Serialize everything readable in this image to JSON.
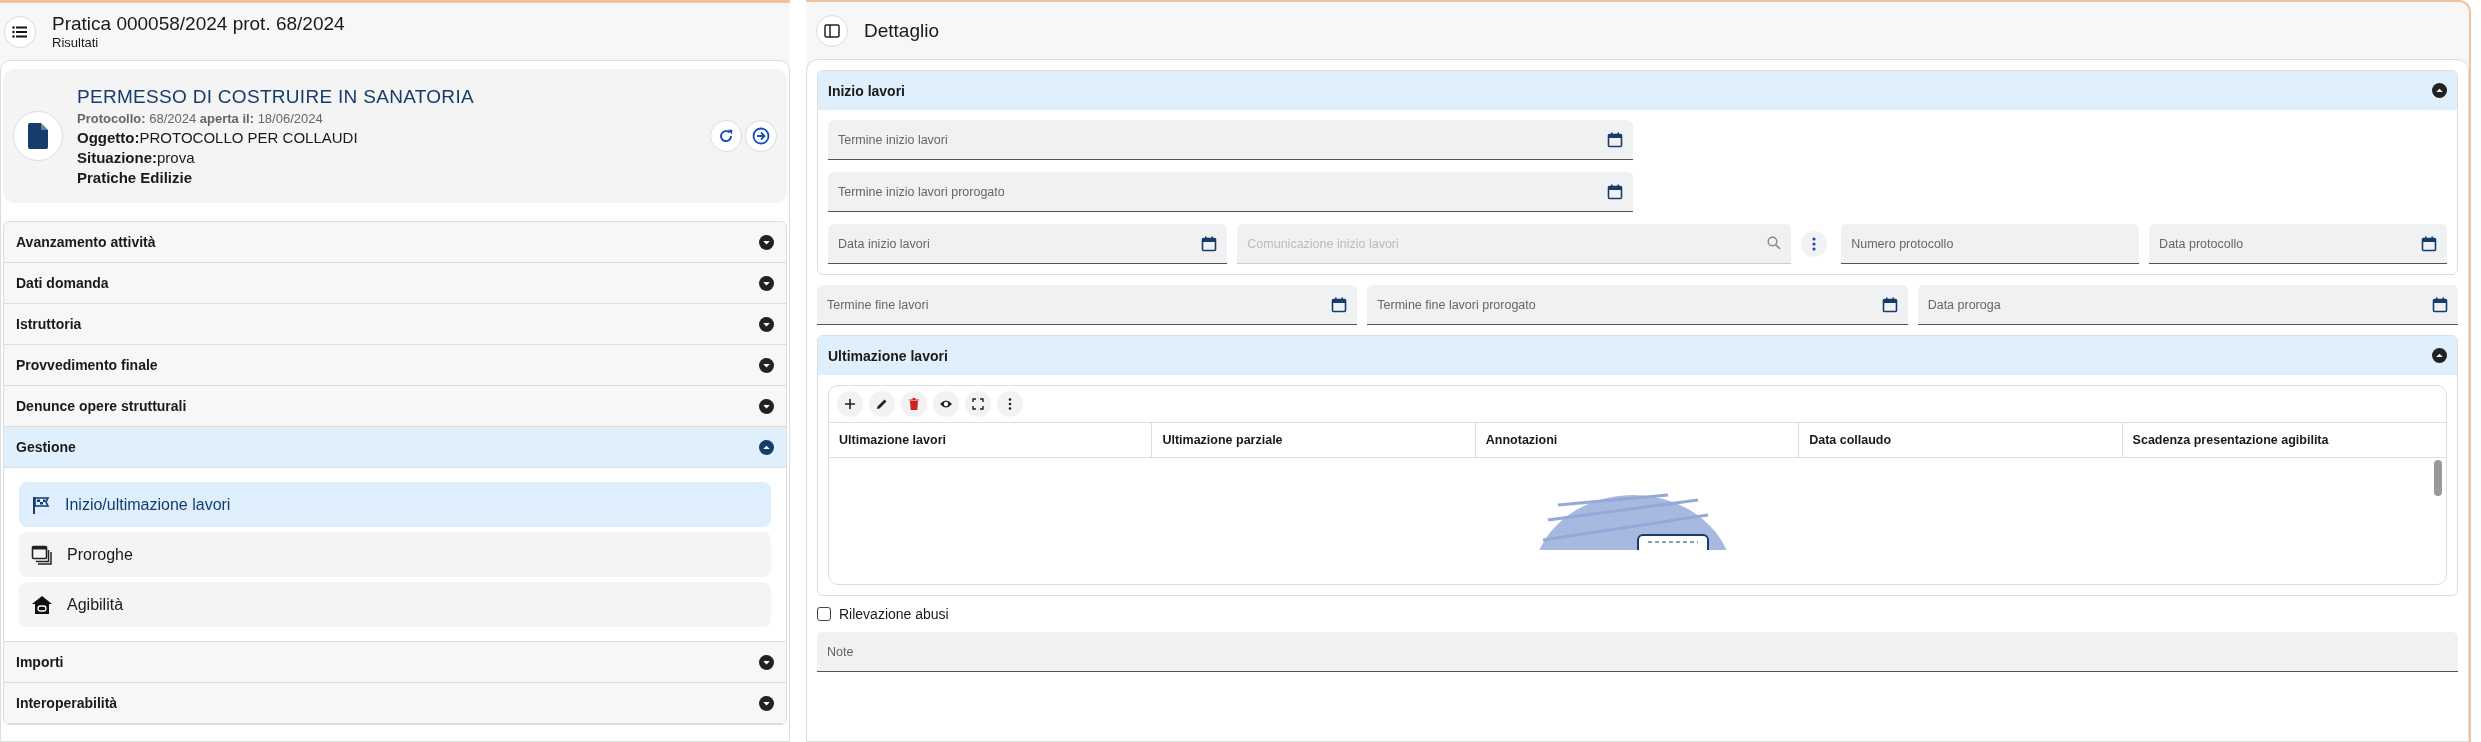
{
  "header": {
    "title": "Pratica 000058/2024 prot. 68/2024",
    "subtitle": "Risultati"
  },
  "practice_card": {
    "title": "PERMESSO DI COSTRUIRE IN SANATORIA",
    "meta": "**Protocollo:** 68/2024 **aperta il:** 18/06/2024",
    "lines": [
      "**Oggetto:**PROTOCOLLO PER COLLAUDI",
      "**Situazione:**prova"
    ],
    "category": "Pratiche Edilizie"
  },
  "sections": [
    {
      "label": "Avanzamento attività",
      "expanded": false
    },
    {
      "label": "Dati domanda",
      "expanded": false
    },
    {
      "label": "Istruttoria",
      "expanded": false
    },
    {
      "label": "Provvedimento finale",
      "expanded": false
    },
    {
      "label": "Denunce opere strutturali",
      "expanded": false
    },
    {
      "label": "Gestione",
      "expanded": true,
      "items": [
        {
          "label": "Inizio/ultimazione lavori",
          "kind": "flag",
          "selected": true
        },
        {
          "label": "Proroghe",
          "kind": "calendar",
          "selected": false
        },
        {
          "label": "Agibilità",
          "kind": "house",
          "selected": false
        }
      ]
    },
    {
      "label": "Importi",
      "expanded": false
    },
    {
      "label": "Interoperabilità",
      "expanded": false
    }
  ],
  "detail": {
    "title": "Dettaglio",
    "start_section": {
      "title": "Inizio lavori",
      "expanded": true,
      "rows": [
        {
          "fields": [
            {
              "placeholder": "Termine inizio lavori",
              "kind": "date",
              "disabled": false
            }
          ]
        },
        {
          "fields": [
            {
              "placeholder": "Termine inizio lavori prorogato",
              "kind": "date",
              "disabled": false
            }
          ]
        },
        {
          "fields": [
            {
              "placeholder": "Data inizio lavori",
              "kind": "date",
              "disabled": false
            },
            {
              "placeholder": "Comunicazione inizio lavori",
              "kind": "search",
              "disabled": true
            },
            {
              "kind": "menu"
            },
            {
              "placeholder": "Numero protocollo",
              "kind": "text",
              "disabled": false
            },
            {
              "placeholder": "Data protocollo",
              "kind": "date",
              "disabled": false
            }
          ]
        }
      ]
    },
    "end_fields": [
      {
        "placeholder": "Termine fine lavori",
        "kind": "date",
        "disabled": false
      },
      {
        "placeholder": "Termine fine lavori prorogato",
        "kind": "date",
        "disabled": false
      },
      {
        "placeholder": "Data proroga",
        "kind": "date",
        "disabled": false
      }
    ],
    "end_section": {
      "title": "Ultimazione lavori",
      "expanded": true,
      "table": {
        "columns": [
          "Ultimazione lavori",
          "Ultimazione parziale",
          "Annotazioni",
          "Data collaudo",
          "Scadenza presentazione agibilita"
        ]
      }
    },
    "abuse_checkbox": {
      "label": "Rilevazione abusi",
      "checked": false
    },
    "note": {
      "placeholder": "Note"
    }
  }
}
